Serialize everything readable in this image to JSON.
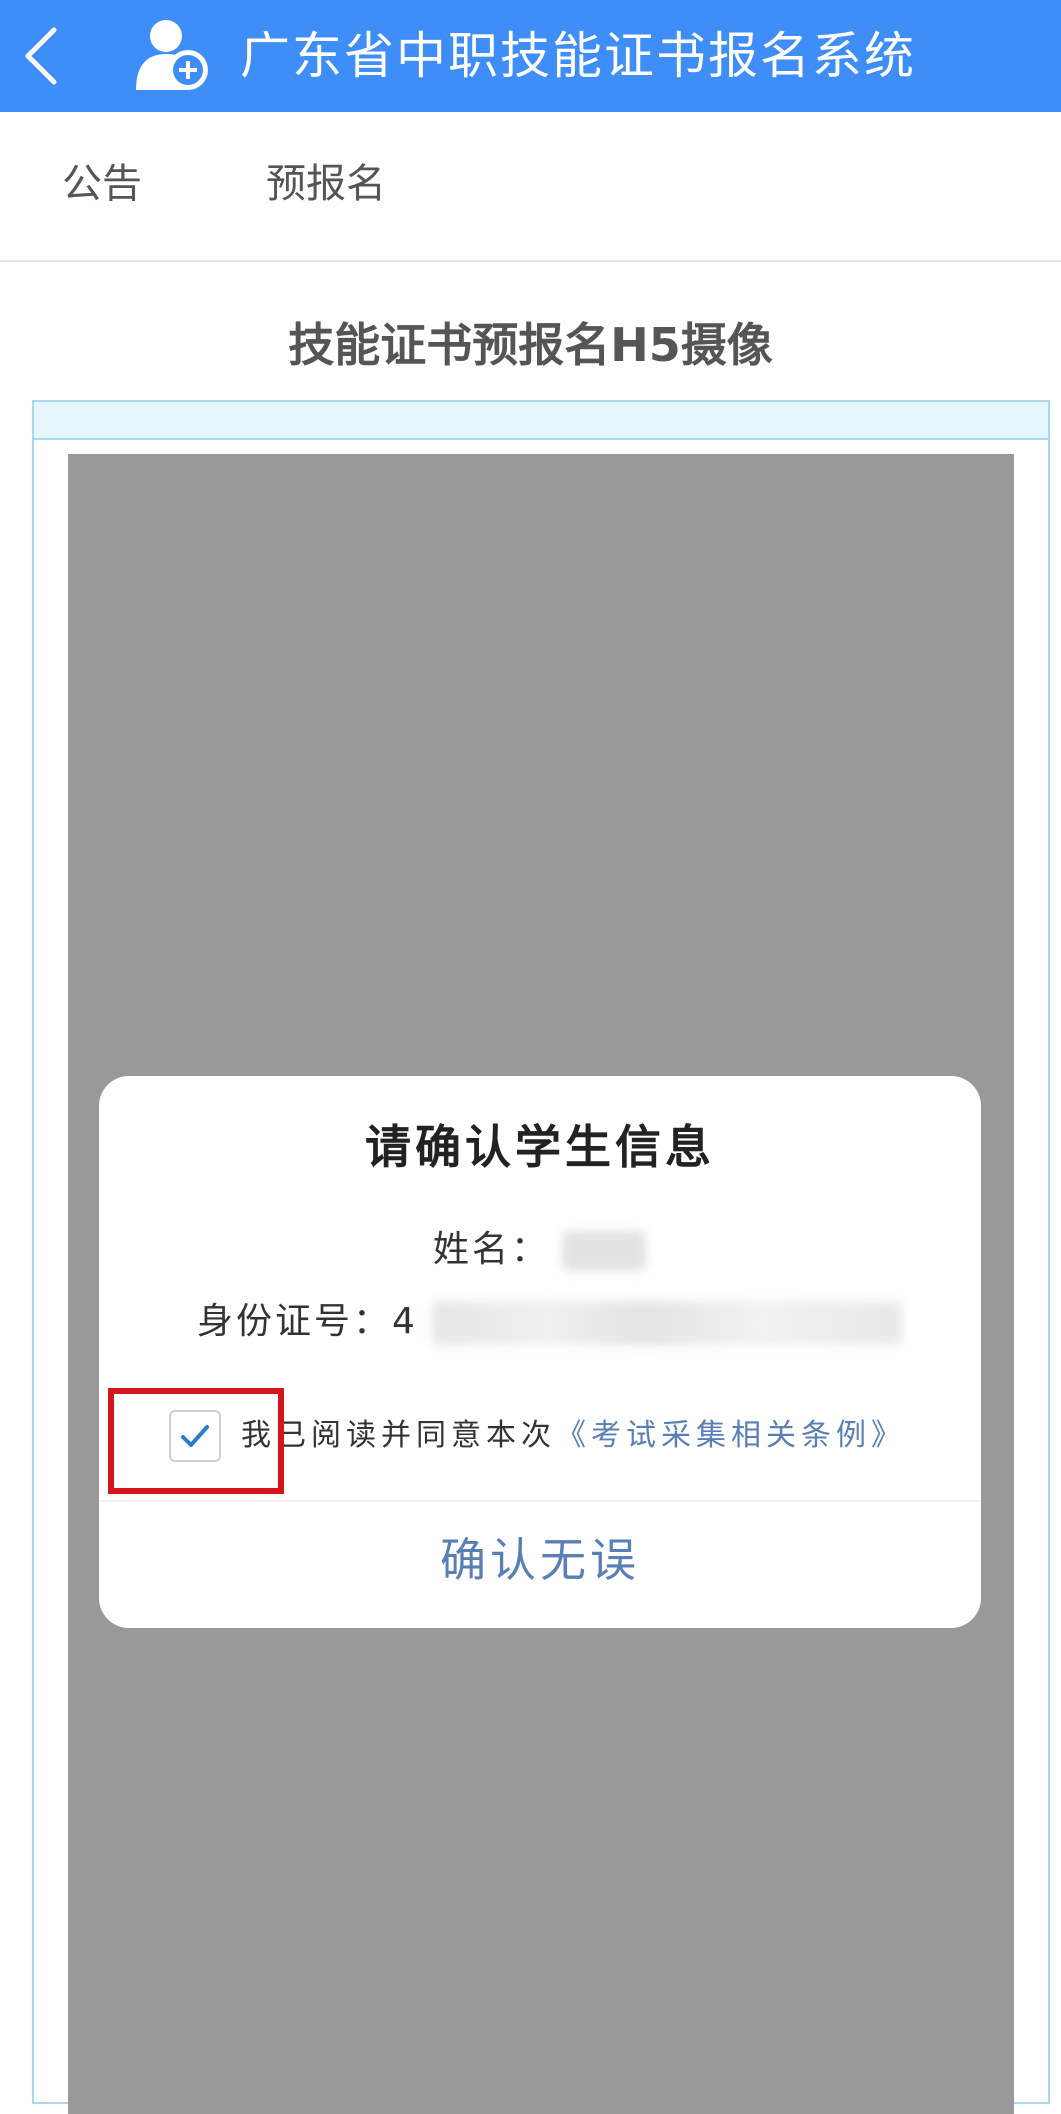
{
  "appbar": {
    "title": "广东省中职技能证书报名系统",
    "back_icon": "chevron-left-icon",
    "logo_icon": "user-add-icon",
    "background": "#3f8ef7"
  },
  "tabs": [
    {
      "label": "公告"
    },
    {
      "label": "预报名"
    }
  ],
  "page": {
    "title": "技能证书预报名H5摄像"
  },
  "modal": {
    "title": "请确认学生信息",
    "name_label": "姓名：",
    "id_label": "身份证号：",
    "id_prefix": "4",
    "agree_text": "我已阅读并同意本次",
    "agree_link": "《考试采集相关条例》",
    "checkbox_checked": true,
    "confirm_label": "确认无误",
    "accent": "#5a7fb4"
  },
  "highlight_color": "#d4161c"
}
